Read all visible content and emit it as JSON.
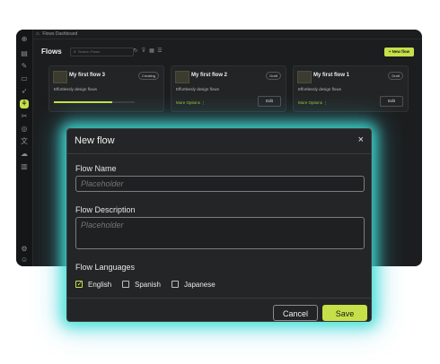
{
  "breadcrumb": {
    "title": "Flows Dashboard"
  },
  "header": {
    "title": "Flows",
    "search_placeholder": "Search Flows",
    "new_flow_label": "+ New flow"
  },
  "toolbar_icons": [
    "refresh-icon",
    "filter-icon",
    "grid-view-icon",
    "list-view-icon"
  ],
  "rail_icons": [
    "home-icon",
    "layers-icon",
    "edit-icon",
    "monitor-icon",
    "rocket-icon",
    "flows-icon",
    "tool-icon",
    "globe-icon",
    "translate-icon",
    "cloud-icon",
    "database-icon",
    "settings-icon",
    "user-icon"
  ],
  "cards": [
    {
      "title": "My first flow 3",
      "badge": "Creating",
      "description": "Effortlessly design flows",
      "progress": 0.72
    },
    {
      "title": "My first flow 2",
      "badge": "Draft",
      "description": "Effortlessly design flows",
      "more_label": "More Options",
      "edit_label": "Edit"
    },
    {
      "title": "My first flow 1",
      "badge": "Draft",
      "description": "Effortlessly design flows",
      "more_label": "More Options",
      "edit_label": "Edit"
    }
  ],
  "modal": {
    "title": "New flow",
    "close_glyph": "×",
    "name_label": "Flow Name",
    "name_placeholder": "Placeholder",
    "description_label": "Flow Description",
    "description_placeholder": "Placeholder",
    "languages_label": "Flow Languages",
    "languages": [
      {
        "label": "English",
        "checked": true
      },
      {
        "label": "Spanish",
        "checked": false
      },
      {
        "label": "Japanese",
        "checked": false
      }
    ],
    "cancel_label": "Cancel",
    "save_label": "Save"
  },
  "colors": {
    "accent": "#c5e14a",
    "glow": "#40e0d6",
    "app_bg": "#1c1d1e",
    "modal_bg": "#242526"
  }
}
